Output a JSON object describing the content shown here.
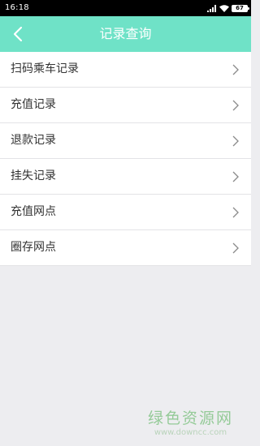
{
  "status_bar": {
    "time": "16:18",
    "battery": "67"
  },
  "header": {
    "title": "记录查询"
  },
  "menu": {
    "items": [
      {
        "label": "扫码乘车记录"
      },
      {
        "label": "充值记录"
      },
      {
        "label": "退款记录"
      },
      {
        "label": "挂失记录"
      },
      {
        "label": "充值网点"
      },
      {
        "label": "圈存网点"
      }
    ]
  },
  "watermark": {
    "text": "绿色资源网",
    "url": "www.downcc.com"
  },
  "colors": {
    "header_bg": "#6fe2c7",
    "page_bg": "#ededf0"
  }
}
